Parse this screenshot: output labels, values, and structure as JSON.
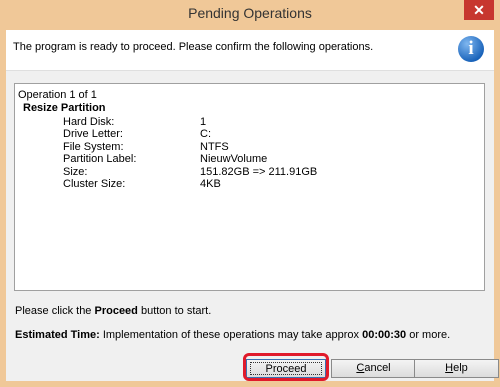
{
  "window": {
    "title": "Pending Operations",
    "close_glyph": "✕"
  },
  "header": {
    "message": "The program is ready to proceed. Please confirm the following operations.",
    "icon": "info-icon"
  },
  "operation": {
    "counter": "Operation 1 of 1",
    "title": "Resize Partition",
    "details": [
      {
        "label": "Hard Disk:",
        "value": "1"
      },
      {
        "label": "Drive Letter:",
        "value": "C:"
      },
      {
        "label": "File System:",
        "value": "NTFS"
      },
      {
        "label": "Partition Label:",
        "value": "NieuwVolume"
      },
      {
        "label": "Size:",
        "value": "151.82GB => 211.91GB"
      },
      {
        "label": "Cluster Size:",
        "value": "4KB"
      }
    ]
  },
  "footer": {
    "hint_pre": "Please click the ",
    "hint_bold": "Proceed",
    "hint_post": " button to start.",
    "estimate_label": "Estimated Time:",
    "estimate_text": " Implementation of these operations may take approx ",
    "estimate_time": "00:00:30",
    "estimate_tail": " or more."
  },
  "buttons": {
    "proceed": "Proceed",
    "cancel_underlined": "C",
    "cancel_rest": "ancel",
    "help_underlined": "H",
    "help_rest": "elp"
  },
  "colors": {
    "titlebar": "#f0c898",
    "close": "#c7372f",
    "highlight": "#e01a2a"
  }
}
